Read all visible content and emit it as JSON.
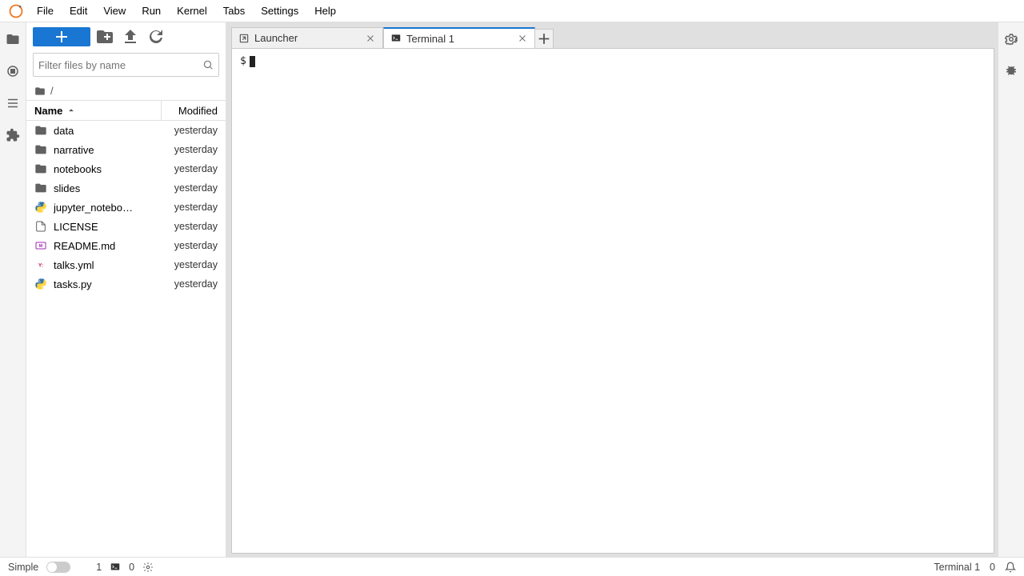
{
  "menu": {
    "items": [
      "File",
      "Edit",
      "View",
      "Run",
      "Kernel",
      "Tabs",
      "Settings",
      "Help"
    ]
  },
  "sidebar": {
    "filter_placeholder": "Filter files by name",
    "breadcrumb": "/",
    "header_name": "Name",
    "header_modified": "Modified",
    "files": [
      {
        "icon": "folder",
        "name": "data",
        "modified": "yesterday"
      },
      {
        "icon": "folder",
        "name": "narrative",
        "modified": "yesterday"
      },
      {
        "icon": "folder",
        "name": "notebooks",
        "modified": "yesterday"
      },
      {
        "icon": "folder",
        "name": "slides",
        "modified": "yesterday"
      },
      {
        "icon": "py",
        "name": "jupyter_notebo…",
        "modified": "yesterday"
      },
      {
        "icon": "file",
        "name": "LICENSE",
        "modified": "yesterday"
      },
      {
        "icon": "md",
        "name": "README.md",
        "modified": "yesterday"
      },
      {
        "icon": "yml",
        "name": "talks.yml",
        "modified": "yesterday"
      },
      {
        "icon": "py",
        "name": "tasks.py",
        "modified": "yesterday"
      }
    ]
  },
  "tabs": {
    "items": [
      {
        "label": "Launcher",
        "active": false,
        "icon": "launcher"
      },
      {
        "label": "Terminal 1",
        "active": true,
        "icon": "terminal"
      }
    ]
  },
  "terminal": {
    "prompt": "$"
  },
  "status": {
    "mode_label": "Simple",
    "kernel_count": "1",
    "terminal_count": "0",
    "right_label": "Terminal 1",
    "right_count": "0"
  }
}
